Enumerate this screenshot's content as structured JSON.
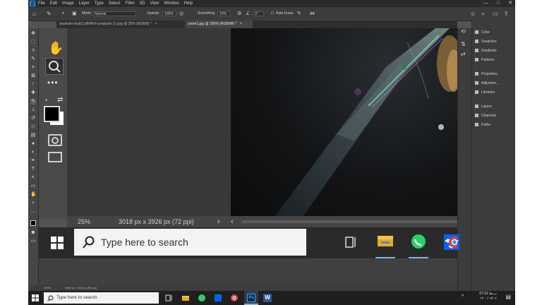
{
  "ps": {
    "logo": "Ps",
    "menus": [
      "File",
      "Edit",
      "Image",
      "Layer",
      "Type",
      "Select",
      "Filter",
      "3D",
      "View",
      "Window",
      "Help"
    ],
    "window_controls": {
      "minimize": "—",
      "maximize": "□",
      "close": "✕"
    },
    "options": {
      "mode_label": "Mode:",
      "mode_value": "Normal",
      "opacity_label": "Opacity:",
      "opacity_value": "100%",
      "smoothing_label": "Smoothing:",
      "smoothing_value": "10%",
      "angle_value": "0°",
      "auto_erase_label": "Auto Erase"
    },
    "tabs": [
      {
        "label": "skamdev-EqUCyl8NRiY-unsplash (1).jpg @ 25% (RGB/8) *",
        "close": "×"
      },
      {
        "label": "zoom1.jpg @ 200% (RGB/8#) *",
        "close": "×"
      }
    ],
    "panels": {
      "group1": [
        "Color",
        "Swatches",
        "Gradients",
        "Patterns"
      ],
      "group2": [
        "Properties",
        "Adjustme...",
        "Libraries"
      ],
      "group3": [
        "Layers",
        "Channels",
        "Paths"
      ]
    },
    "status_big": {
      "zoom": "25%",
      "dims": "3018 px x 3926 px (72 ppi)",
      "arrow_right": "›",
      "arrow_left": "‹"
    },
    "status_small": {
      "zoom": "200%",
      "dims": "1660 px x 900 px (96 ppi)"
    },
    "big_taskbar": {
      "search_placeholder": "Type here to search"
    }
  },
  "windows": {
    "search_placeholder": "Type here to search",
    "clock_time": "07:32 ب.ظ",
    "clock_date": "۱۴۰۰/۰۷/۰۶"
  },
  "colors": {
    "ps_dark": "#2b2b2b",
    "ps_panel": "#3c3c3c",
    "ps_accent": "#31a8ff",
    "taskbar": "#1f1f1f"
  }
}
